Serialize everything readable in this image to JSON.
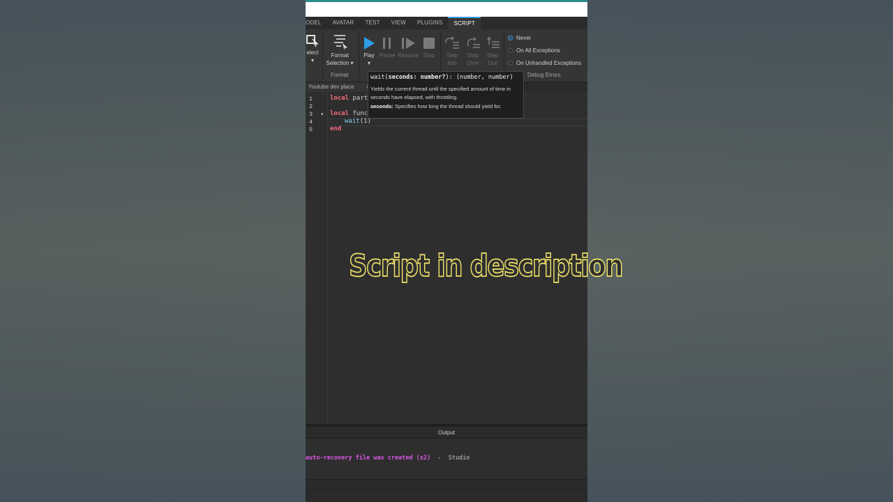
{
  "menu": {
    "tabs": [
      "ODEL",
      "AVATAR",
      "TEST",
      "VIEW",
      "PLUGINS",
      "SCRIPT"
    ],
    "active": "SCRIPT"
  },
  "ribbon": {
    "select_label_1": "elect",
    "select_label_2": "▾",
    "format_selection_label_1": "Format",
    "format_selection_label_2": "Selection ▾",
    "format_group": "Format",
    "play": "Play",
    "play_arrow": "▾",
    "pause": "Pause",
    "resume": "Resume",
    "stop": "Stop",
    "step_into_1": "Step",
    "step_into_2": "Into",
    "step_over_1": "Step",
    "step_over_2": "Over",
    "step_out_1": "Step",
    "step_out_2": "Out",
    "debug_options": [
      "Never",
      "On All Exceptions",
      "On Unhandled Exceptions"
    ],
    "debug_selected": "Never",
    "debug_group": "Debug Errors",
    "accent_color": "#3c9be0"
  },
  "document_tab": {
    "title": "Youtube dev place",
    "close": "×"
  },
  "editor": {
    "line_numbers": [
      "1",
      "2",
      "3",
      "4",
      "5"
    ],
    "fold_marker": "▾",
    "line1_kw": "local",
    "line1_rest": " part",
    "line3_kw": "local",
    "line3_rest": " func",
    "line4_fn": "wait",
    "line4_rest": "(1)",
    "line5_kw": "end"
  },
  "tooltip": {
    "sig_prefix": "wait(",
    "sig_param": "seconds: number?",
    "sig_suffix": "): (number, number)",
    "description": "Yields the current thread until the specified amount of time in seconds have elapsed, with throttling.",
    "param_name": "seconds:",
    "param_desc": " Specifies how long the thread should yield for."
  },
  "overlay": {
    "text": "Script in description",
    "color": "#f2e56a"
  },
  "output": {
    "title": "Output",
    "message": "auto-recovery file was created (x2)",
    "separator": "  -  ",
    "source": "Studio",
    "message_color": "#d957e4"
  }
}
